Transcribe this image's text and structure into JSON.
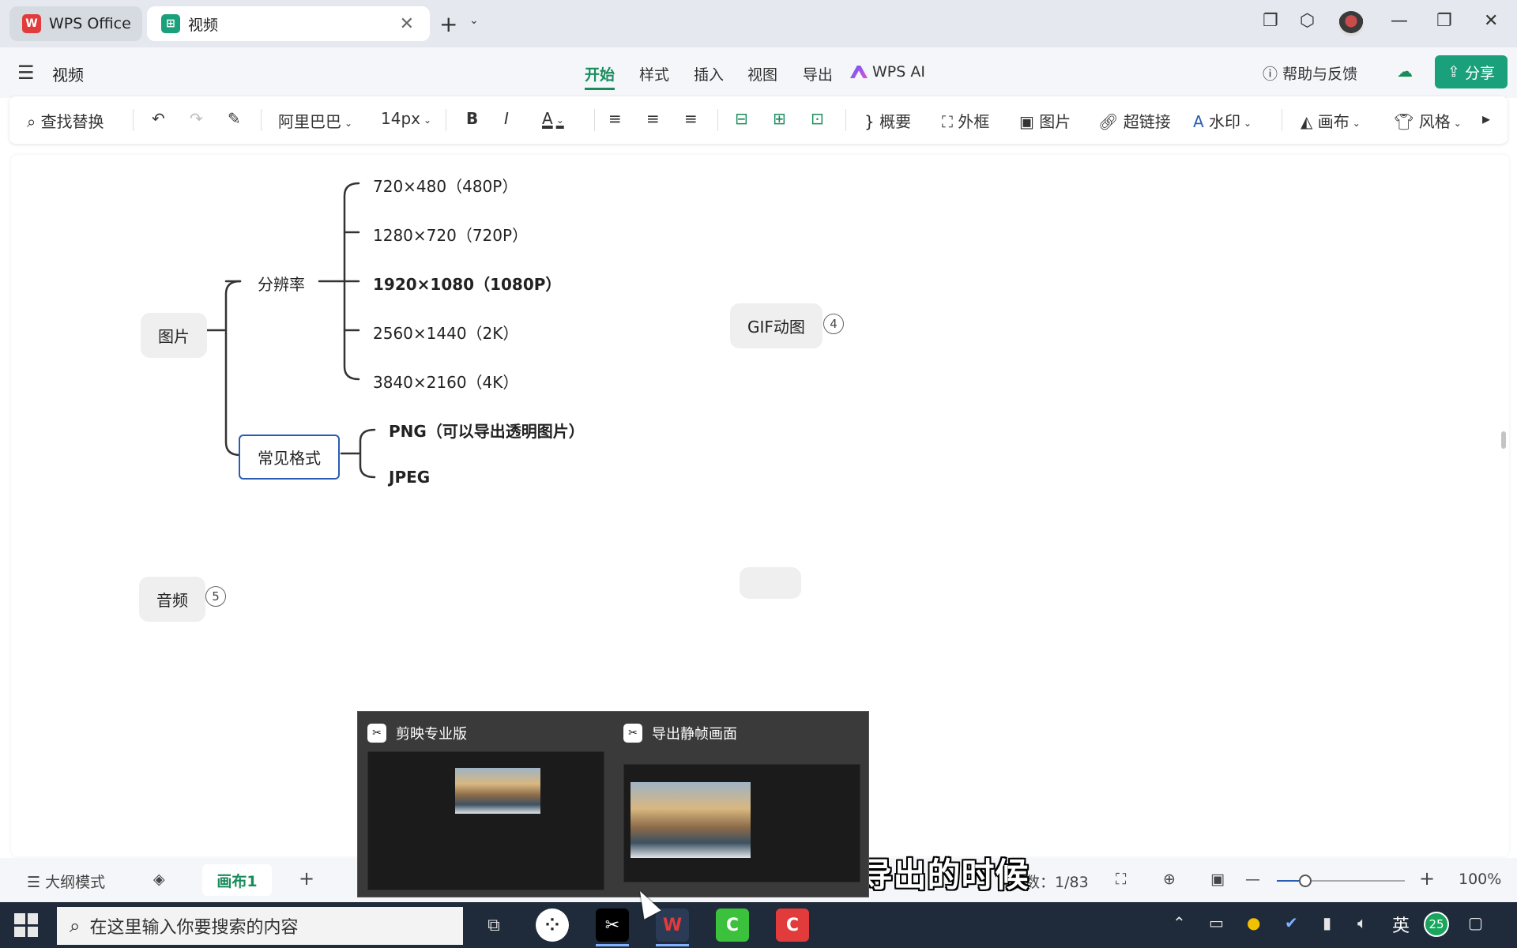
{
  "titlebar": {
    "home_tab": "WPS Office",
    "doc_tab": "视频",
    "close_tab": "✕",
    "new_tab": "+",
    "tab_menu": "⌄"
  },
  "menubar": {
    "doc_title": "视频",
    "tabs": [
      {
        "label": "开始",
        "active": true
      },
      {
        "label": "样式"
      },
      {
        "label": "插入"
      },
      {
        "label": "视图"
      },
      {
        "label": "导出"
      }
    ],
    "ai": "WPS AI",
    "help": "帮助与反馈",
    "share": "分享"
  },
  "toolbar": {
    "find_replace": "查找替换",
    "font": "阿里巴巴",
    "font_size": "14px",
    "summary": "概要",
    "frame": "外框",
    "image": "图片",
    "hyperlink": "超链接",
    "watermark": "水印",
    "canvas": "画布",
    "style": "风格"
  },
  "mindmap": {
    "picture": "图片",
    "resolution": "分辨率",
    "res_items": [
      "720×480（480P）",
      "1280×720（720P）",
      "1920×1080（1080P）",
      "2560×1440（2K）",
      "3840×2160（4K）"
    ],
    "formats": "常见格式",
    "format_items": [
      "PNG（可以导出透明图片）",
      "JPEG"
    ],
    "gif": "GIF动图",
    "gif_count": "4",
    "audio": "音频",
    "audio_count": "5"
  },
  "statusbar": {
    "outline_mode": "大纲模式",
    "sheet": "画布1",
    "add_sheet": "+",
    "topic_count_label": "题数：",
    "topic_count": "1/83",
    "zoom": "100%",
    "zoom_fraction": 0.22
  },
  "taskbar": {
    "search_placeholder": "在这里输入你要搜索的内容",
    "lang": "英",
    "notif_count": "25"
  },
  "popup": {
    "left_title": "剪映专业版",
    "right_title": "导出静帧画面"
  },
  "subtitle": "也就是在剪映专业版里导出的时候",
  "colors": {
    "accent_green": "#1a8c5c",
    "share_bg": "#1aa07a",
    "selected_border": "#2b5cb4",
    "branch_line": "#333333"
  }
}
